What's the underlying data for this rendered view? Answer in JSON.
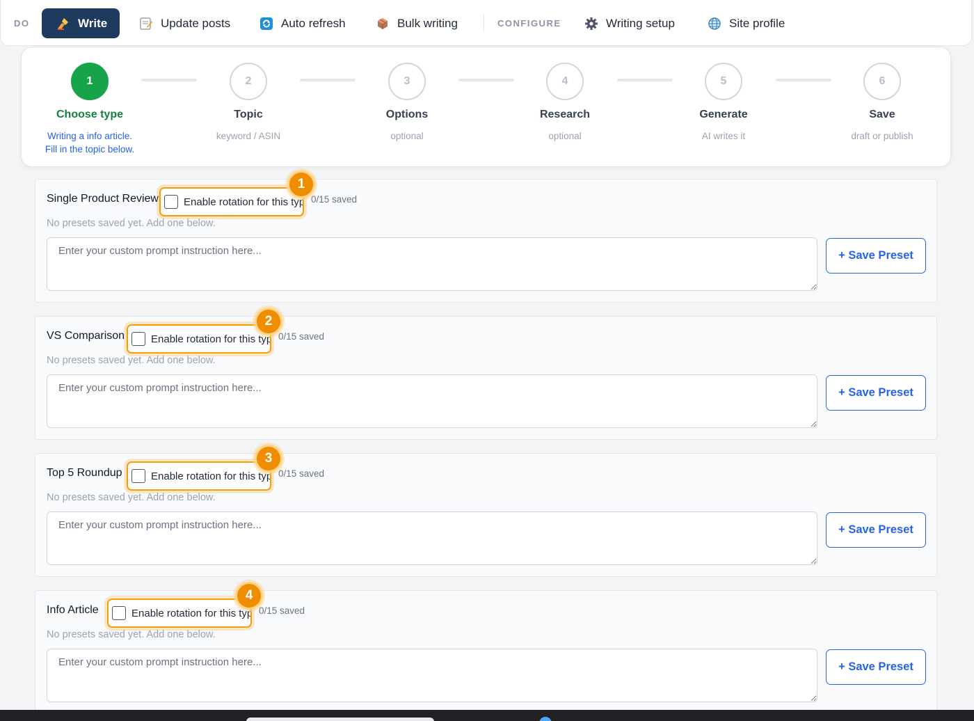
{
  "nav": {
    "section_do": "DO",
    "section_configure": "CONFIGURE",
    "items": [
      {
        "label": "Write",
        "icon": "writing-hand-icon",
        "active": true
      },
      {
        "label": "Update posts",
        "icon": "memo-icon"
      },
      {
        "label": "Auto refresh",
        "icon": "refresh-icon"
      },
      {
        "label": "Bulk writing",
        "icon": "package-icon"
      },
      {
        "label": "Writing setup",
        "icon": "gear-icon"
      },
      {
        "label": "Site profile",
        "icon": "globe-icon"
      }
    ]
  },
  "stepper": {
    "steps": [
      {
        "number": "1",
        "title": "Choose type",
        "sub": "Writing a info article.",
        "sub2": "Fill in the topic below.",
        "state": "done"
      },
      {
        "number": "2",
        "title": "Topic",
        "sub": "keyword / ASIN"
      },
      {
        "number": "3",
        "title": "Options",
        "sub": "optional"
      },
      {
        "number": "4",
        "title": "Research",
        "sub": "optional"
      },
      {
        "number": "5",
        "title": "Generate",
        "sub": "AI writes it"
      },
      {
        "number": "6",
        "title": "Save",
        "sub": "draft or publish"
      }
    ]
  },
  "presets": {
    "rotation_label": "Enable rotation for this type",
    "empty_note": "No presets saved yet. Add one below.",
    "prompt_placeholder": "Enter your custom prompt instruction here...",
    "save_label": "+ Save Preset",
    "cards": [
      {
        "title": "Single Product Review",
        "badge": "1",
        "saved": "0/15 saved"
      },
      {
        "title": "VS Comparison",
        "badge": "2",
        "saved": "0/15 saved"
      },
      {
        "title": "Top 5 Roundup",
        "badge": "3",
        "saved": "0/15 saved"
      },
      {
        "title": "Info Article",
        "badge": "4",
        "saved": "0/15 saved"
      }
    ]
  },
  "colors": {
    "accent": "#2563eb",
    "nav_active": "#1e3a5f",
    "step_done": "#17a34a",
    "highlight": "#f59e0b"
  }
}
